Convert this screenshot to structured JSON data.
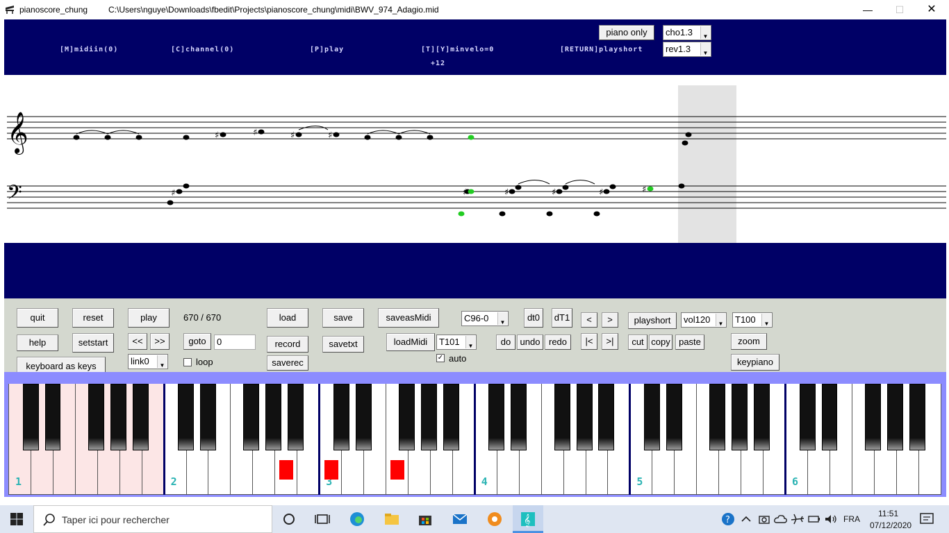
{
  "window": {
    "app_name": "pianoscore_chung",
    "file_path": "C:\\Users\\nguye\\Downloads\\fbedit\\Projects\\pianoscore_chung\\midi\\BWV_974_Adagio.mid",
    "minimize": "—",
    "maximize": "☐",
    "close": "✕"
  },
  "header": {
    "midiin": "[M]midiin(0)",
    "channel": "[C]channel(0)",
    "play": "[P]play",
    "minvelo": "[T][Y]minvelo=0",
    "playshort": "[RETURN]playshort",
    "transpose": "+12",
    "piano_only": "piano only",
    "cho": "cho1.3",
    "rev": "rev1.3"
  },
  "controls": {
    "quit": "quit",
    "reset": "reset",
    "play": "play",
    "position": "670 / 670",
    "load": "load",
    "save": "save",
    "saveasmidi": "saveasMidi",
    "c96": "C96-0",
    "dt0": "dt0",
    "dt1": "dT1",
    "prev": "<",
    "next": ">",
    "playshort": "playshort",
    "vol": "vol120",
    "tempo": "T100",
    "help": "help",
    "setstart": "setstart",
    "rewind": "<<",
    "forward": ">>",
    "goto": "goto",
    "goto_value": "0",
    "record": "record",
    "savetxt": "savetxt",
    "loadmidi": "loadMidi",
    "t101": "T101",
    "do": "do",
    "undo": "undo",
    "redo": "redo",
    "first": "|<",
    "last": ">|",
    "cut": "cut",
    "copy": "copy",
    "paste": "paste",
    "zoom": "zoom",
    "keyboard_as_keys": "keyboard as keys",
    "link": "link0",
    "loop": "loop",
    "saverec": "saverec",
    "auto": "auto",
    "auto_check": "✓",
    "keypiano": "keypiano"
  },
  "keyboard": {
    "octaves": [
      "1",
      "2",
      "3",
      "4",
      "5",
      "6"
    ]
  },
  "taskbar": {
    "search_placeholder": "Taper ici pour rechercher",
    "lang": "FRA",
    "time": "11:51",
    "date": "07/12/2020"
  },
  "colors": {
    "header_blue": "#000066",
    "panel_grey": "#d4d8cf",
    "keyboard_frame": "#8c8cff",
    "active_note": "#22cc22",
    "pressed_key": "#ff0000"
  }
}
